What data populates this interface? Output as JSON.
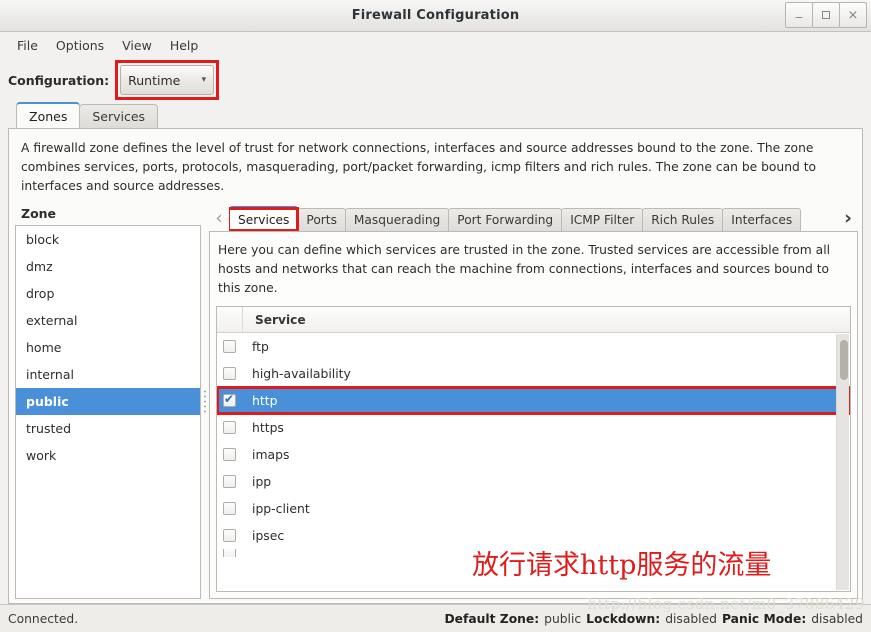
{
  "window": {
    "title": "Firewall Configuration",
    "buttons": {
      "minimize": "_",
      "maximize": "",
      "close": "×"
    }
  },
  "menubar": {
    "items": [
      "File",
      "Options",
      "View",
      "Help"
    ]
  },
  "config": {
    "label": "Configuration:",
    "selected": "Runtime",
    "chevron": "⌄",
    "highlight_color": "#e01b1b"
  },
  "outer_tabs": {
    "items": [
      {
        "label": "Zones",
        "active": true
      },
      {
        "label": "Services",
        "active": false
      }
    ]
  },
  "zone_description": "A firewalld zone defines the level of trust for network connections, interfaces and source addresses bound to the zone. The zone combines services, ports, protocols, masquerading, port/packet forwarding, icmp filters and rich rules. The zone can be bound to interfaces and source addresses.",
  "zone_panel": {
    "header": "Zone",
    "items": [
      {
        "label": "block",
        "selected": false
      },
      {
        "label": "dmz",
        "selected": false
      },
      {
        "label": "drop",
        "selected": false
      },
      {
        "label": "external",
        "selected": false
      },
      {
        "label": "home",
        "selected": false
      },
      {
        "label": "internal",
        "selected": false
      },
      {
        "label": "public",
        "selected": true
      },
      {
        "label": "trusted",
        "selected": false
      },
      {
        "label": "work",
        "selected": false
      }
    ],
    "selection_color": "#4a90d9"
  },
  "inner_tabs": {
    "prev_arrow": "‹",
    "next_arrow": "›",
    "items": [
      {
        "label": "Services",
        "active": true,
        "highlighted": true
      },
      {
        "label": "Ports",
        "active": false,
        "highlighted": false
      },
      {
        "label": "Masquerading",
        "active": false,
        "highlighted": false
      },
      {
        "label": "Port Forwarding",
        "active": false,
        "highlighted": false
      },
      {
        "label": "ICMP Filter",
        "active": false,
        "highlighted": false
      },
      {
        "label": "Rich Rules",
        "active": false,
        "highlighted": false
      },
      {
        "label": "Interfaces",
        "active": false,
        "highlighted": false
      }
    ]
  },
  "services_panel": {
    "description": "Here you can define which services are trusted in the zone. Trusted services are accessible from all hosts and networks that can reach the machine from connections, interfaces and sources bound to this zone.",
    "column_header": "Service",
    "rows": [
      {
        "label": "ftp",
        "checked": false,
        "selected": false
      },
      {
        "label": "high-availability",
        "checked": false,
        "selected": false
      },
      {
        "label": "http",
        "checked": true,
        "selected": true
      },
      {
        "label": "https",
        "checked": false,
        "selected": false
      },
      {
        "label": "imaps",
        "checked": false,
        "selected": false
      },
      {
        "label": "ipp",
        "checked": false,
        "selected": false
      },
      {
        "label": "ipp-client",
        "checked": false,
        "selected": false
      },
      {
        "label": "ipsec",
        "checked": false,
        "selected": false
      }
    ]
  },
  "annotation": {
    "text": "放行请求http服务的流量",
    "color": "#e01b1b"
  },
  "statusbar": {
    "connection": "Connected.",
    "default_zone_label": "Default Zone:",
    "default_zone_value": "public",
    "lockdown_label": "Lockdown:",
    "lockdown_value": "disabled",
    "panic_label": "Panic Mode:",
    "panic_value": "disabled"
  },
  "watermark": "http://blog.csdn.net/m0_37886429"
}
